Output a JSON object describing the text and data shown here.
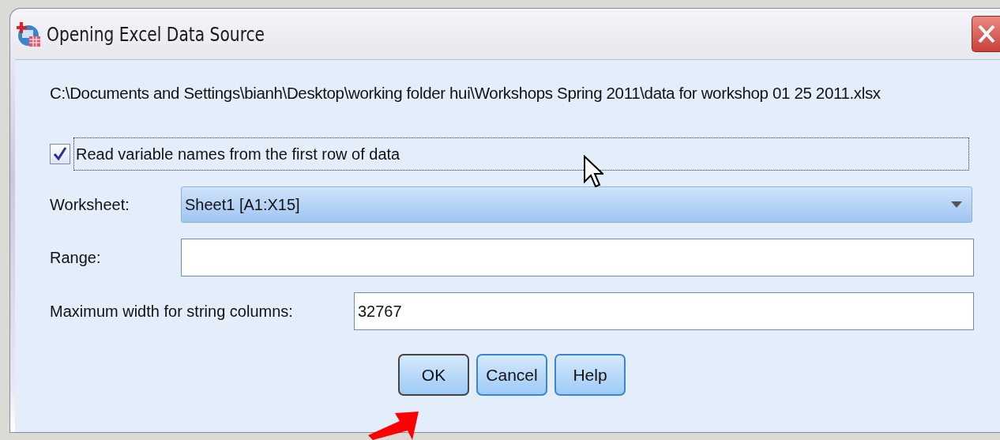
{
  "window": {
    "title": "Opening Excel Data Source"
  },
  "file_path": "C:\\Documents and Settings\\bianh\\Desktop\\working folder hui\\Workshops Spring 2011\\data for workshop 01 25 2011.xlsx",
  "read_names": {
    "label": "Read variable names from the first row of data",
    "checked": true
  },
  "worksheet": {
    "label": "Worksheet:",
    "value": "Sheet1 [A1:X15]"
  },
  "range": {
    "label": "Range:"
  },
  "max_width": {
    "label": "Maximum width for string columns:",
    "value": "32767"
  },
  "buttons": [
    {
      "label": "OK",
      "focused": true
    },
    {
      "label": "Cancel",
      "focused": false
    },
    {
      "label": "Help",
      "focused": false
    }
  ]
}
